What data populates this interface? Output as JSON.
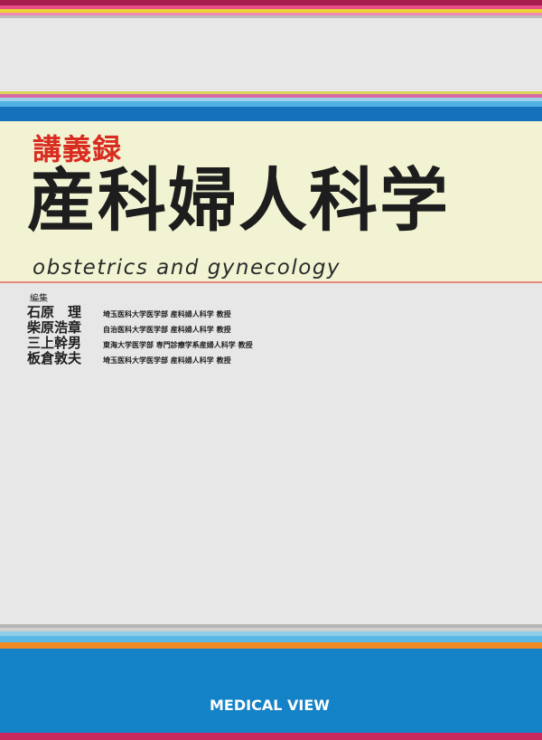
{
  "cover": {
    "series": "講義録",
    "title": "産科婦人科学",
    "subtitle": "obstetrics and gynecology",
    "editor_label": "編集",
    "editors": [
      {
        "name": "石原　理",
        "affiliation": "埼玉医科大学医学部 産科婦人科学 教授"
      },
      {
        "name": "柴原浩章",
        "affiliation": "自治医科大学医学部 産科婦人科学 教授"
      },
      {
        "name": "三上幹男",
        "affiliation": "東海大学医学部 専門診療学系産婦人科学 教授"
      },
      {
        "name": "板倉敦夫",
        "affiliation": "埼玉医科大学医学部 産科婦人科学 教授"
      }
    ],
    "publisher": "MEDICAL VIEW"
  },
  "colors": {
    "series_red": "#d92c21",
    "title_bg": "#f2f3d2",
    "band_blue": "#1482c6",
    "band_orange": "#f08a25",
    "band_magenta": "#c82a5e"
  }
}
